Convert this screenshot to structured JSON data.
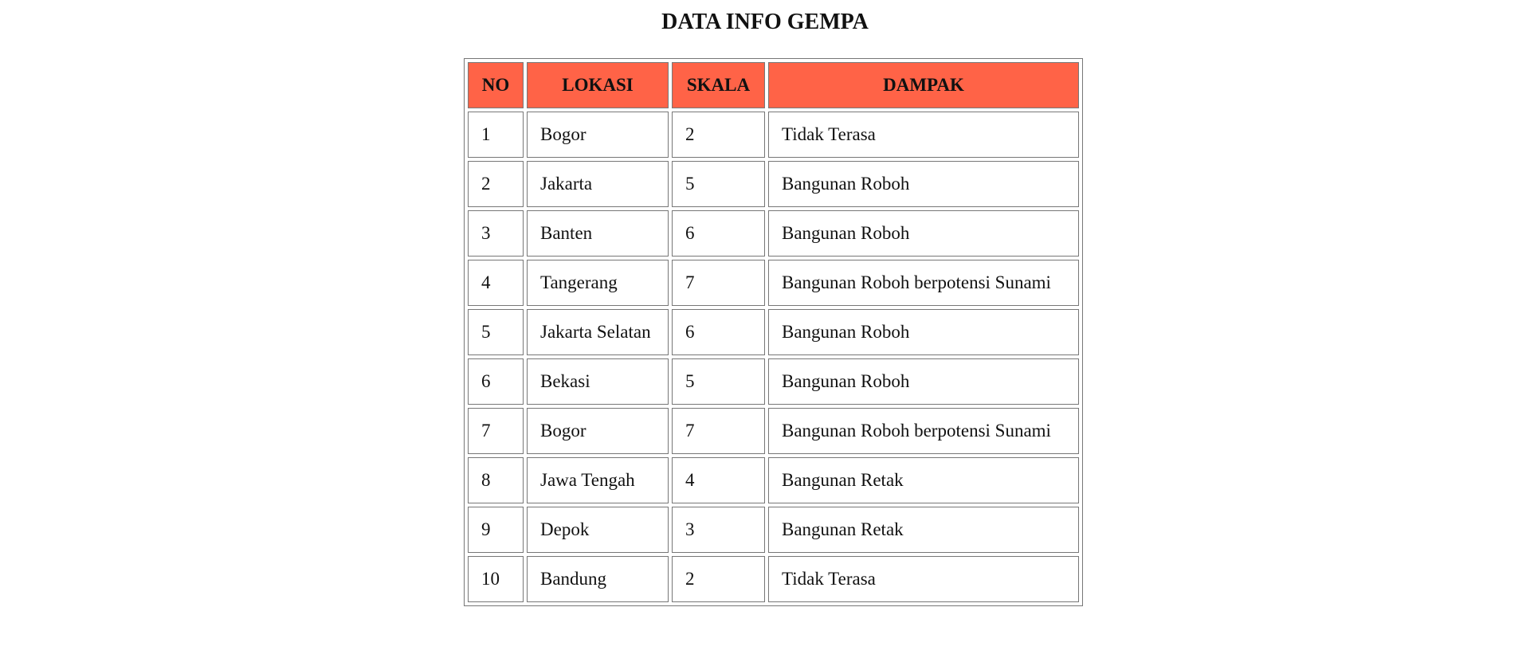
{
  "page": {
    "title": "DATA INFO GEMPA"
  },
  "table": {
    "header_color": "#ff6347",
    "headers": {
      "no": "NO",
      "lokasi": "LOKASI",
      "skala": "SKALA",
      "dampak": "DAMPAK"
    },
    "rows": [
      {
        "no": "1",
        "lokasi": "Bogor",
        "skala": "2",
        "dampak": "Tidak Terasa"
      },
      {
        "no": "2",
        "lokasi": "Jakarta",
        "skala": "5",
        "dampak": "Bangunan Roboh"
      },
      {
        "no": "3",
        "lokasi": "Banten",
        "skala": "6",
        "dampak": "Bangunan Roboh"
      },
      {
        "no": "4",
        "lokasi": "Tangerang",
        "skala": "7",
        "dampak": "Bangunan Roboh berpotensi Sunami"
      },
      {
        "no": "5",
        "lokasi": "Jakarta Selatan",
        "skala": "6",
        "dampak": "Bangunan Roboh"
      },
      {
        "no": "6",
        "lokasi": "Bekasi",
        "skala": "5",
        "dampak": "Bangunan Roboh"
      },
      {
        "no": "7",
        "lokasi": "Bogor",
        "skala": "7",
        "dampak": "Bangunan Roboh berpotensi Sunami"
      },
      {
        "no": "8",
        "lokasi": "Jawa Tengah",
        "skala": "4",
        "dampak": "Bangunan Retak"
      },
      {
        "no": "9",
        "lokasi": "Depok",
        "skala": "3",
        "dampak": "Bangunan Retak"
      },
      {
        "no": "10",
        "lokasi": "Bandung",
        "skala": "2",
        "dampak": "Tidak Terasa"
      }
    ]
  }
}
